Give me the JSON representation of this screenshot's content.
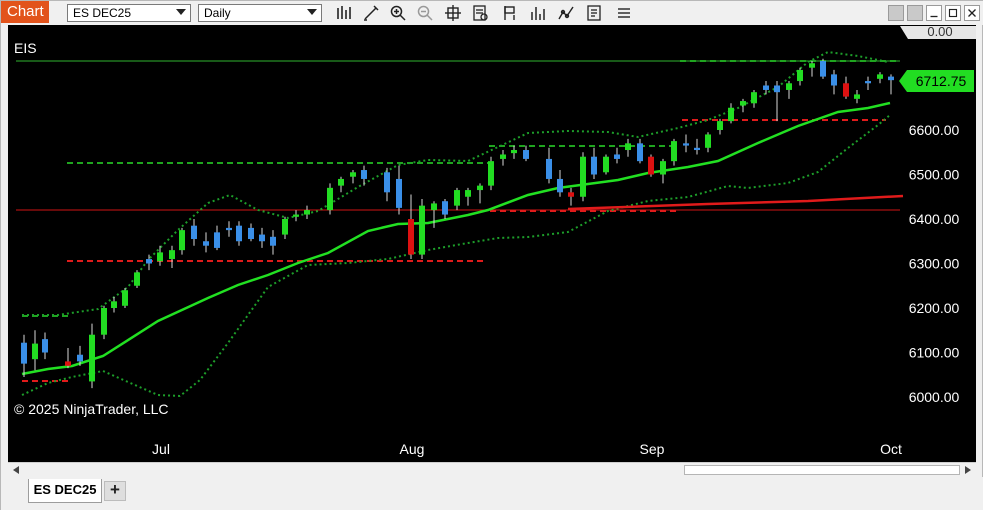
{
  "toolbar": {
    "chart_label": "Chart",
    "instrument": "ES DEC25",
    "interval": "Daily",
    "icons": [
      "bar-type-icon",
      "drawing-pencil-icon",
      "zoom-in-icon",
      "zoom-out-icon",
      "crosshair-icon",
      "data-box-icon",
      "strategies-icon",
      "indicators-icon",
      "chart-trader-icon",
      "properties-icon",
      "more-options-icon"
    ]
  },
  "window": {
    "buttons": [
      "restore-icon",
      "minimize-icon",
      "maximize-icon",
      "close-icon"
    ]
  },
  "chart": {
    "symbol_label": "EIS",
    "copyright": "© 2025 NinjaTrader, LLC",
    "last_price": "6712.75",
    "top_value": "0.00",
    "colors": {
      "background": "#000000",
      "up_candle": "#22dd22",
      "down_candle": "#dd1111",
      "neutral_candle": "#3a8fe8",
      "sma": "#22e022",
      "bands": "#1d9e2a",
      "trend": "#e01b1b",
      "price_tag": "#22dd22"
    }
  },
  "chart_data": {
    "type": "candlestick",
    "y_axis_ticks": [
      "6000.00",
      "6100.00",
      "6200.00",
      "6300.00",
      "6400.00",
      "6500.00",
      "6600.00"
    ],
    "x_axis_ticks": [
      "Jul",
      "Aug",
      "Sep",
      "Oct"
    ],
    "ylim": [
      5990,
      6740
    ]
  },
  "tabs": {
    "active": "ES DEC25",
    "add_label": "+"
  }
}
